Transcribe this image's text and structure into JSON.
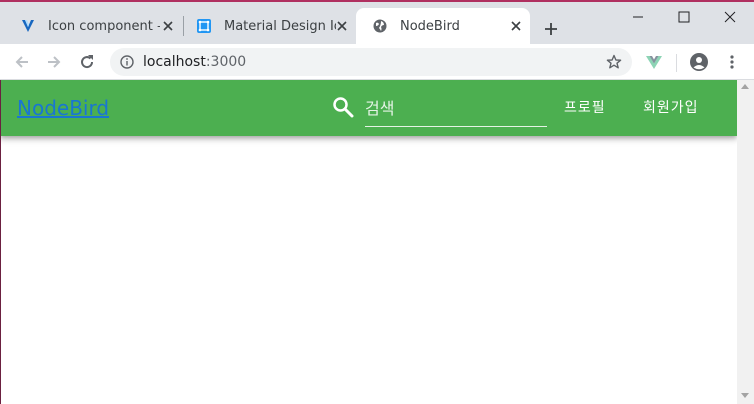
{
  "browser": {
    "tabs": [
      {
        "title": "Icon component —",
        "favicon": "vuetify-icon"
      },
      {
        "title": "Material Design Icons",
        "favicon": "material-design-icon"
      },
      {
        "title": "NodeBird",
        "favicon": "globe-icon"
      }
    ],
    "active_tab_index": 2,
    "address": {
      "host": "localhost",
      "port": ":3000"
    },
    "colors": {
      "tabstrip": "#dee1e6",
      "frame_accent": "#b03060"
    }
  },
  "app": {
    "brand": "NodeBird",
    "search": {
      "placeholder": "검색",
      "value": ""
    },
    "nav": {
      "profile": "프로필",
      "signup": "회원가입"
    },
    "colors": {
      "appbar": "#4caf50",
      "brand_link": "#1976d2"
    }
  }
}
